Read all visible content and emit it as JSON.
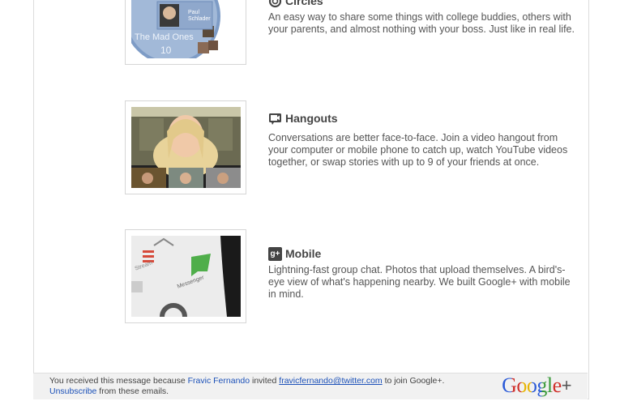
{
  "features": [
    {
      "title": "Circles",
      "icon": "circles-icon",
      "description": "An easy way to share some things with college buddies, others with your parents, and almost nothing with your boss. Just like in real life.",
      "image": {
        "circle_name": "The Mad Ones",
        "circle_count": "10",
        "person_name": "Paul Schlader"
      }
    },
    {
      "title": "Hangouts",
      "icon": "hangouts-icon",
      "description": "Conversations are better face-to-face. Join a video hangout from your computer or mobile phone to catch up, watch YouTube videos together, or swap stories with up to 9 of your friends at once."
    },
    {
      "title": "Mobile",
      "icon": "gplus-mobile-icon",
      "icon_text": "g+",
      "description": "Lightning-fast group chat. Photos that upload themselves. A bird's-eye view of what's happening nearby. We built Google+ with mobile in mind.",
      "image": {
        "label_stream": "Stream",
        "label_messenger": "Messenger"
      }
    }
  ],
  "footer": {
    "text1": "You received this message because ",
    "sender_name": "Fravic Fernando",
    "text2": " invited ",
    "email": "fravicfernando@twitter.com",
    "text3": " to join Google+.",
    "unsubscribe": "Unsubscribe",
    "text4": " from these emails."
  },
  "logo": {
    "text": "Google",
    "plus": "+"
  },
  "colors": {
    "link": "#1c51b8",
    "text": "#555555",
    "title": "#444444"
  }
}
